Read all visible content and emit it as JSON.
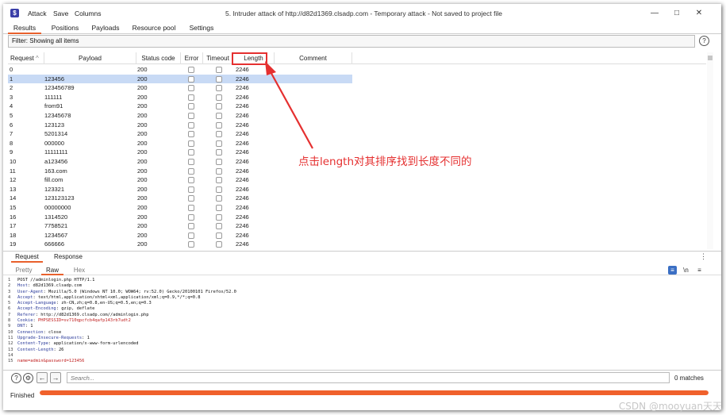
{
  "titlebar": {
    "menus": [
      "Attack",
      "Save",
      "Columns"
    ],
    "title": "5. Intruder attack of http://d82d1369.clsadp.com - Temporary attack - Not saved to project file",
    "app_icon_glyph": "$"
  },
  "tabs": [
    "Results",
    "Positions",
    "Payloads",
    "Resource pool",
    "Settings"
  ],
  "filter": {
    "label": "Filter: Showing all items"
  },
  "table": {
    "columns": [
      "Request",
      "Payload",
      "Status code",
      "Error",
      "Timeout",
      "Length",
      "Comment"
    ],
    "selected_row_index": 1,
    "rows": [
      {
        "request": "0",
        "payload": "",
        "status": "200",
        "length": "2246"
      },
      {
        "request": "1",
        "payload": "123456",
        "status": "200",
        "length": "2246"
      },
      {
        "request": "2",
        "payload": "123456789",
        "status": "200",
        "length": "2246"
      },
      {
        "request": "3",
        "payload": "111111",
        "status": "200",
        "length": "2246"
      },
      {
        "request": "4",
        "payload": "from91",
        "status": "200",
        "length": "2246"
      },
      {
        "request": "5",
        "payload": "12345678",
        "status": "200",
        "length": "2246"
      },
      {
        "request": "6",
        "payload": "123123",
        "status": "200",
        "length": "2246"
      },
      {
        "request": "7",
        "payload": "5201314",
        "status": "200",
        "length": "2246"
      },
      {
        "request": "8",
        "payload": "000000",
        "status": "200",
        "length": "2246"
      },
      {
        "request": "9",
        "payload": "11111111",
        "status": "200",
        "length": "2246"
      },
      {
        "request": "10",
        "payload": "a123456",
        "status": "200",
        "length": "2246"
      },
      {
        "request": "11",
        "payload": "163.com",
        "status": "200",
        "length": "2246"
      },
      {
        "request": "12",
        "payload": "fill.com",
        "status": "200",
        "length": "2246"
      },
      {
        "request": "13",
        "payload": "123321",
        "status": "200",
        "length": "2246"
      },
      {
        "request": "14",
        "payload": "123123123",
        "status": "200",
        "length": "2246"
      },
      {
        "request": "15",
        "payload": "00000000",
        "status": "200",
        "length": "2246"
      },
      {
        "request": "16",
        "payload": "1314520",
        "status": "200",
        "length": "2246"
      },
      {
        "request": "17",
        "payload": "7758521",
        "status": "200",
        "length": "2246"
      },
      {
        "request": "18",
        "payload": "1234567",
        "status": "200",
        "length": "2246"
      },
      {
        "request": "19",
        "payload": "666666",
        "status": "200",
        "length": "2246"
      }
    ]
  },
  "annotation": {
    "text": "点击length对其排序找到长度不同的",
    "color": "#e53030"
  },
  "bottom": {
    "subtabs": [
      "Request",
      "Response"
    ],
    "viewtabs": [
      "Pretty",
      "Raw",
      "Hex"
    ],
    "active_view": "Raw",
    "request_lines": [
      {
        "num": "1",
        "key": "",
        "text": "POST //adminlogin.php HTTP/1.1"
      },
      {
        "num": "2",
        "key": "Host",
        "text": "d82d1369.clsadp.com"
      },
      {
        "num": "3",
        "key": "User-Agent",
        "text": "Mozilla/5.0 (Windows NT 10.0; WOW64; rv:52.0) Gecko/20100101 Firefox/52.0"
      },
      {
        "num": "4",
        "key": "Accept",
        "text": "text/html,application/xhtml+xml,application/xml;q=0.9,*/*;q=0.8"
      },
      {
        "num": "5",
        "key": "Accept-Language",
        "text": "zh-CN,zh;q=0.8,en-US;q=0.5,en;q=0.3"
      },
      {
        "num": "6",
        "key": "Accept-Encoding",
        "text": "gzip, deflate"
      },
      {
        "num": "7",
        "key": "Referer",
        "text": "http://d82d1369.clsadp.com//adminlogin.php"
      },
      {
        "num": "8",
        "key": "Cookie",
        "text": "PHPSESSID=sv710qpcfcb4qafp143rb7udt2"
      },
      {
        "num": "9",
        "key": "DNT",
        "text": "1"
      },
      {
        "num": "10",
        "key": "Connection",
        "text": "close"
      },
      {
        "num": "11",
        "key": "Upgrade-Insecure-Requests",
        "text": "1"
      },
      {
        "num": "12",
        "key": "Content-Type",
        "text": "application/x-www-form-urlencoded"
      },
      {
        "num": "13",
        "key": "Content-Length",
        "text": "26"
      },
      {
        "num": "14",
        "key": "",
        "text": ""
      },
      {
        "num": "15",
        "key": "",
        "text": "name=admin&password=123456"
      }
    ]
  },
  "search": {
    "placeholder": "Search...",
    "matches": "0 matches"
  },
  "status": {
    "text": "Finished",
    "progress_percent": 100,
    "progress_color": "#f0612c"
  },
  "watermark": "CSDN @mooyuan天天",
  "icons": {
    "help": "question-circle-icon",
    "settings": "gear-icon",
    "prev": "arrow-left-icon",
    "next": "arrow-right-icon"
  }
}
